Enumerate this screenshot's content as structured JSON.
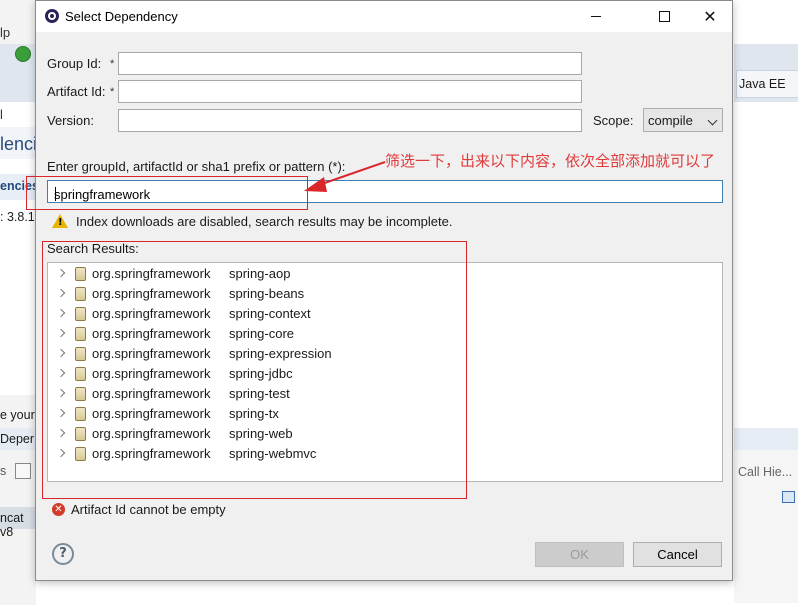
{
  "background": {
    "menu_fragment": "lp",
    "tab_fragment": "l",
    "heading_fragment": "lenci",
    "section_fragment": "encies",
    "version_fragment": ": 3.8.1",
    "leave_fragment": "e your",
    "depend_fragment": "Deper",
    "s_fragment": "s",
    "tomcat_fragment": "ncat v8",
    "perspective_label": "Java EE",
    "call_hierarchy": "Call Hie..."
  },
  "dialog": {
    "title": "Select Dependency",
    "group_id_label": "Group Id:",
    "artifact_id_label": "Artifact Id:",
    "version_label": "Version:",
    "required_mark": "*",
    "group_id_value": "",
    "artifact_id_value": "",
    "version_value": "",
    "scope_label": "Scope:",
    "scope_value": "compile",
    "search_label": "Enter groupId, artifactId or sha1 prefix or pattern (*):",
    "search_value": "springframework",
    "warning_text": "Index downloads are disabled, search results may be incomplete.",
    "results_label": "Search Results:",
    "results": [
      {
        "group": "org.springframework",
        "artifact": "spring-aop"
      },
      {
        "group": "org.springframework",
        "artifact": "spring-beans"
      },
      {
        "group": "org.springframework",
        "artifact": "spring-context"
      },
      {
        "group": "org.springframework",
        "artifact": "spring-core"
      },
      {
        "group": "org.springframework",
        "artifact": "spring-expression"
      },
      {
        "group": "org.springframework",
        "artifact": "spring-jdbc"
      },
      {
        "group": "org.springframework",
        "artifact": "spring-test"
      },
      {
        "group": "org.springframework",
        "artifact": "spring-tx"
      },
      {
        "group": "org.springframework",
        "artifact": "spring-web"
      },
      {
        "group": "org.springframework",
        "artifact": "spring-webmvc"
      }
    ],
    "error_text": "Artifact Id cannot be empty",
    "ok_label": "OK",
    "cancel_label": "Cancel",
    "help_symbol": "?"
  },
  "annotation": {
    "note": "筛选一下，出来以下内容，依次全部添加就可以了",
    "color": "#d9262b"
  },
  "icons": [
    "app-icon",
    "minimize-icon",
    "maximize-icon",
    "close-icon",
    "warning-icon",
    "expand-chevron-icon",
    "jar-icon",
    "error-icon",
    "help-icon",
    "dropdown-chevron-icon"
  ]
}
